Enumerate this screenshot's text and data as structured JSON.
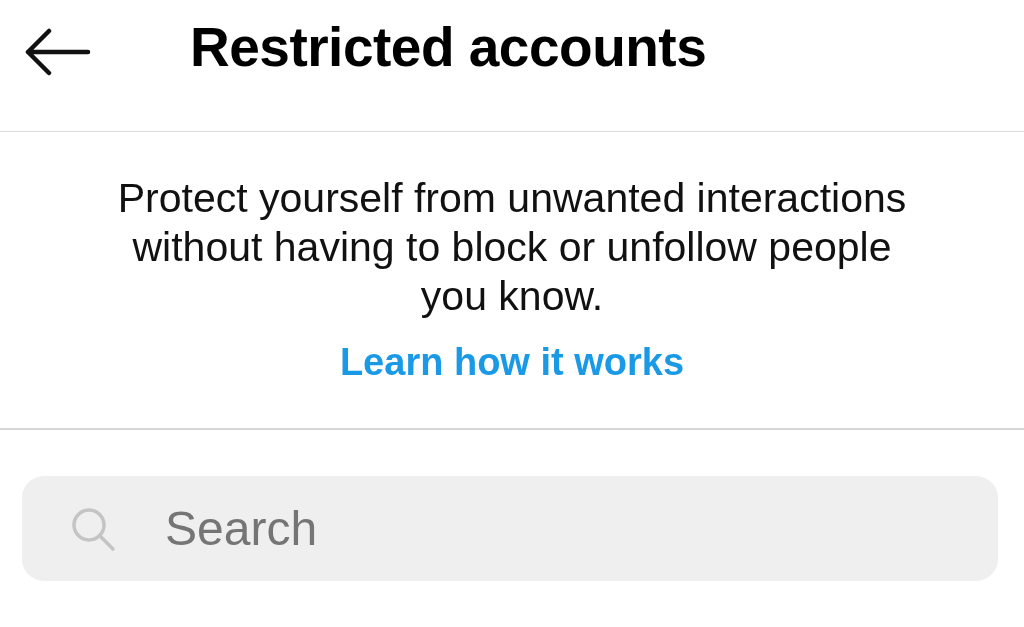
{
  "header": {
    "title": "Restricted accounts"
  },
  "intro": {
    "description": "Protect yourself from unwanted interactions without having to block or unfollow people you know.",
    "link": "Learn how it works"
  },
  "search": {
    "placeholder": "Search"
  }
}
